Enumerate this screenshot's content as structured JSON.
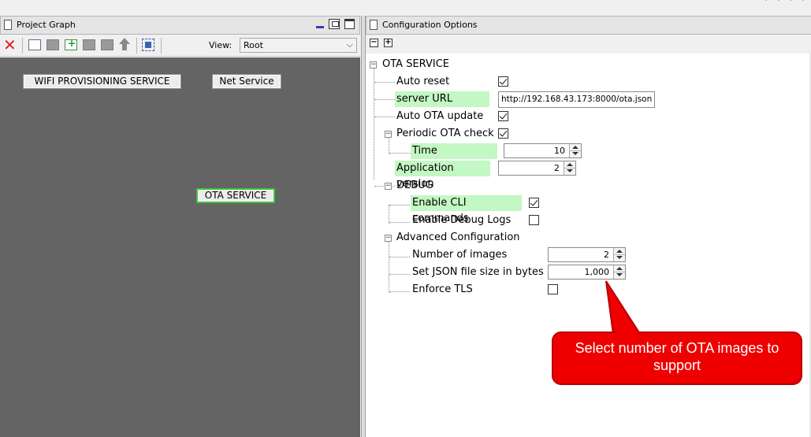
{
  "left_panel": {
    "title": "Project Graph",
    "toolbar": {
      "delete_icon": "delete-red-x-icon",
      "view_label": "View:",
      "view_value": "Root"
    },
    "nodes": [
      {
        "label": "WIFI PROVISIONING SERVICE",
        "selected": false
      },
      {
        "label": "Net Service",
        "selected": false
      },
      {
        "label": "OTA SERVICE",
        "selected": true
      }
    ]
  },
  "right_panel": {
    "title": "Configuration Options",
    "collapse_all": "−",
    "expand_all": "+",
    "tree": {
      "root_label": "OTA SERVICE",
      "auto_reset": {
        "label": "Auto reset",
        "checked": true
      },
      "server_url": {
        "label": "server URL",
        "value": "http://192.168.43.173:8000/ota.json"
      },
      "auto_ota_update": {
        "label": "Auto OTA update",
        "checked": true
      },
      "periodic_ota_check": {
        "label": "Periodic OTA check",
        "checked": true
      },
      "time_interval": {
        "label": "Time inerval(sec)",
        "value": "10"
      },
      "application_version": {
        "label": "Application version",
        "value": "2"
      },
      "debug": {
        "label": "DEBUG"
      },
      "enable_cli": {
        "label": "Enable CLI commands",
        "checked": true
      },
      "enable_debug_logs": {
        "label": "Enable Debug Logs",
        "checked": false
      },
      "advanced": {
        "label": "Advanced Configuration"
      },
      "number_of_images": {
        "label": "Number of images",
        "value": "2"
      },
      "json_file_size": {
        "label": "Set JSON file size in bytes",
        "value": "1,000"
      },
      "enforce_tls": {
        "label": "Enforce TLS",
        "checked": false
      }
    }
  },
  "callout": {
    "line1": "Select number of OTA images to",
    "line2": "support",
    "color": "#ee0000"
  },
  "colors": {
    "canvas_bg": "#646464",
    "highlight": "#c3f7c3",
    "selected_node_border": "#3cc43c"
  }
}
